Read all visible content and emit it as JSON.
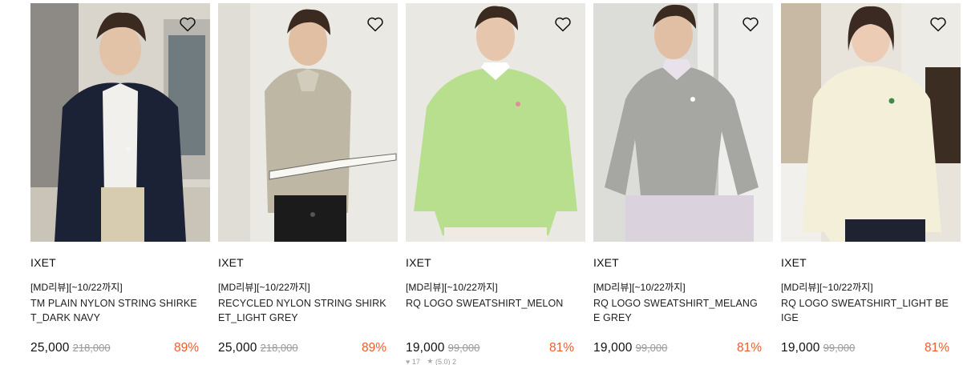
{
  "icons": {
    "wishlist": "heart-outline-icon",
    "likes": "heart-icon",
    "rating": "star-icon"
  },
  "colors": {
    "discount": "#f05a28",
    "original_price": "#999999"
  },
  "products": [
    {
      "brand": "IXET",
      "tag": "[MD리뷰][~10/22까지]",
      "name": "TM PLAIN NYLON STRING SHIRKET_DARK NAVY",
      "price": "25,000",
      "original_price": "218,000",
      "discount": "89%"
    },
    {
      "brand": "IXET",
      "tag": "[MD리뷰][~10/22까지]",
      "name": "RECYCLED NYLON STRING SHIRKET_LIGHT GREY",
      "price": "25,000",
      "original_price": "218,000",
      "discount": "89%"
    },
    {
      "brand": "IXET",
      "tag": "[MD리뷰][~10/22까지]",
      "name": "RQ LOGO SWEATSHIRT_MELON",
      "price": "19,000",
      "original_price": "99,000",
      "discount": "81%",
      "likes": "17",
      "rating": "(5.0) 2"
    },
    {
      "brand": "IXET",
      "tag": "[MD리뷰][~10/22까지]",
      "name": "RQ LOGO SWEATSHIRT_MELANGE GREY",
      "price": "19,000",
      "original_price": "99,000",
      "discount": "81%"
    },
    {
      "brand": "IXET",
      "tag": "[MD리뷰][~10/22까지]",
      "name": "RQ LOGO SWEATSHIRT_LIGHT BEIGE",
      "price": "19,000",
      "original_price": "99,000",
      "discount": "81%"
    }
  ]
}
